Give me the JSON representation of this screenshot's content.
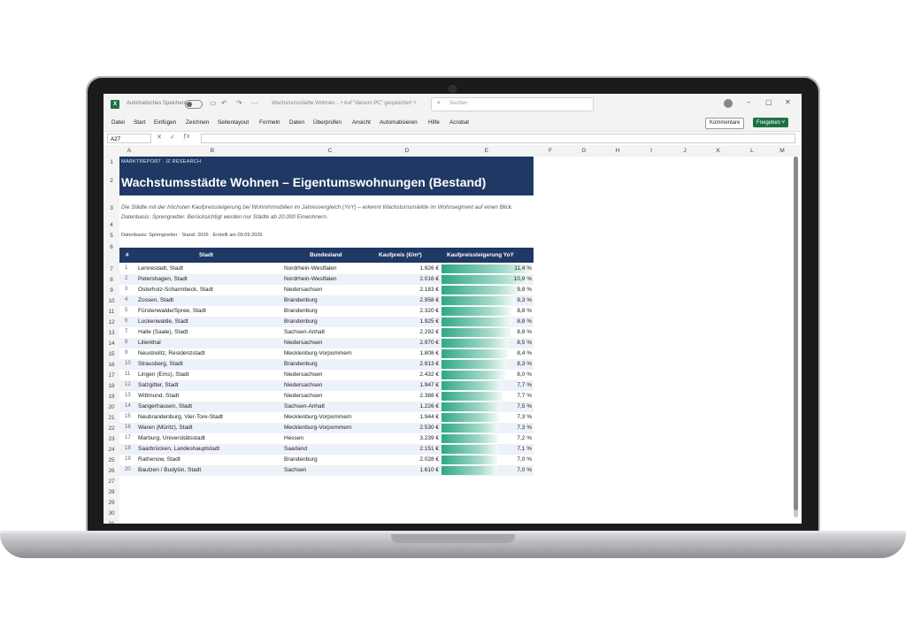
{
  "window": {
    "app_icon": "X",
    "autosave_label": "Automatisches Speichern",
    "doc_title": "Wachstumsstädte Wohnen... • Auf \"diesem PC\" gespeichert ˅",
    "search_placeholder": "Suchen"
  },
  "menu": [
    "Datei",
    "Start",
    "Einfügen",
    "Zeichnen",
    "Seitenlayout",
    "Formeln",
    "Daten",
    "Überprüfen",
    "Ansicht",
    "Automatisieren",
    "Hilfe",
    "Acrobat"
  ],
  "buttons": {
    "comments": "Kommentare",
    "share": "Freigeben ˅"
  },
  "formula_bar": {
    "name_box": "A27",
    "fx": "ƒx"
  },
  "columns": [
    "A",
    "B",
    "C",
    "D",
    "E",
    "F",
    "G",
    "H",
    "I",
    "J",
    "K",
    "L",
    "M"
  ],
  "rows": [
    "1",
    "2",
    "3",
    "4",
    "5",
    "6",
    "7",
    "8",
    "9",
    "10",
    "11",
    "12",
    "13",
    "14",
    "15",
    "16",
    "17",
    "18",
    "19",
    "20",
    "21",
    "22",
    "23",
    "24",
    "25",
    "26",
    "27",
    "28",
    "29",
    "30",
    "31"
  ],
  "report": {
    "kicker": "MARKTREPORT · IZ RESEARCH",
    "title": "Wachstumsstädte Wohnen – Eigentumswohnungen (Bestand)",
    "subtitle": "Die Städte mit der höchsten Kaufpreissteigerung bei Wohnimmobilien im Jahresvergleich (YoY) – erkennt Wachstumsmärkte im Wohnsegment auf einen Blick. Datenbasis: Sprengnetter. Berücksichtigt werden nur Städte ab 20.000 Einwohnern.",
    "meta": "Datenbasis: Sprengnetter   ·   Stand: 2026   ·   Erstellt am 09.09.2026"
  },
  "table": {
    "headers": [
      "#",
      "Stadt",
      "Bundesland",
      "Kaufpreis (€/m²)",
      "Kaufpreissteigerung YoY"
    ],
    "max_yoy": 11.4,
    "rows": [
      {
        "n": "1",
        "city": "Lennestadt, Stadt",
        "state": "Nordrhein-Westfalen",
        "price": "1.926 €",
        "yoy": "11,4 %",
        "v": 11.4
      },
      {
        "n": "2",
        "city": "Petershagen, Stadt",
        "state": "Nordrhein-Westfalen",
        "price": "2.016 €",
        "yoy": "10,9 %",
        "v": 10.9
      },
      {
        "n": "3",
        "city": "Osterholz-Scharmbeck, Stadt",
        "state": "Niedersachsen",
        "price": "2.183 €",
        "yoy": "9,8 %",
        "v": 9.8
      },
      {
        "n": "4",
        "city": "Zossen, Stadt",
        "state": "Brandenburg",
        "price": "2.958 €",
        "yoy": "9,3 %",
        "v": 9.3
      },
      {
        "n": "5",
        "city": "Fürstenwalde/Spree, Stadt",
        "state": "Brandenburg",
        "price": "2.320 €",
        "yoy": "8,8 %",
        "v": 8.8
      },
      {
        "n": "6",
        "city": "Luckenwalde, Stadt",
        "state": "Brandenburg",
        "price": "1.925 €",
        "yoy": "8,8 %",
        "v": 8.8
      },
      {
        "n": "7",
        "city": "Halle (Saale), Stadt",
        "state": "Sachsen-Anhalt",
        "price": "2.292 €",
        "yoy": "8,8 %",
        "v": 8.8
      },
      {
        "n": "8",
        "city": "Lilienthal",
        "state": "Niedersachsen",
        "price": "2.970 €",
        "yoy": "8,5 %",
        "v": 8.5
      },
      {
        "n": "9",
        "city": "Neustrelitz, Residenzstadt",
        "state": "Mecklenburg-Vorpommern",
        "price": "1.808 €",
        "yoy": "8,4 %",
        "v": 8.4
      },
      {
        "n": "10",
        "city": "Strausberg, Stadt",
        "state": "Brandenburg",
        "price": "2.913 €",
        "yoy": "8,3 %",
        "v": 8.3
      },
      {
        "n": "11",
        "city": "Lingen (Ems), Stadt",
        "state": "Niedersachsen",
        "price": "2.432 €",
        "yoy": "8,0 %",
        "v": 8.0
      },
      {
        "n": "12",
        "city": "Salzgitter, Stadt",
        "state": "Niedersachsen",
        "price": "1.947 €",
        "yoy": "7,7 %",
        "v": 7.7
      },
      {
        "n": "13",
        "city": "Wittmund, Stadt",
        "state": "Niedersachsen",
        "price": "2.388 €",
        "yoy": "7,7 %",
        "v": 7.7
      },
      {
        "n": "14",
        "city": "Sangerhausen, Stadt",
        "state": "Sachsen-Anhalt",
        "price": "1.226 €",
        "yoy": "7,5 %",
        "v": 7.5
      },
      {
        "n": "15",
        "city": "Neubrandenburg, Vier-Tore-Stadt",
        "state": "Mecklenburg-Vorpommern",
        "price": "1.944 €",
        "yoy": "7,3 %",
        "v": 7.3
      },
      {
        "n": "16",
        "city": "Waren (Müritz), Stadt",
        "state": "Mecklenburg-Vorpommern",
        "price": "2.530 €",
        "yoy": "7,3 %",
        "v": 7.3
      },
      {
        "n": "17",
        "city": "Marburg, Universitätsstadt",
        "state": "Hessen",
        "price": "3.239 €",
        "yoy": "7,2 %",
        "v": 7.2
      },
      {
        "n": "18",
        "city": "Saarbrücken, Landeshauptstadt",
        "state": "Saarland",
        "price": "2.151 €",
        "yoy": "7,1 %",
        "v": 7.1
      },
      {
        "n": "19",
        "city": "Rathenow, Stadt",
        "state": "Brandenburg",
        "price": "2.028 €",
        "yoy": "7,0 %",
        "v": 7.0
      },
      {
        "n": "20",
        "city": "Bautzen / Budyšin, Stadt",
        "state": "Sachsen",
        "price": "1.610 €",
        "yoy": "7,0 %",
        "v": 7.0
      }
    ]
  }
}
